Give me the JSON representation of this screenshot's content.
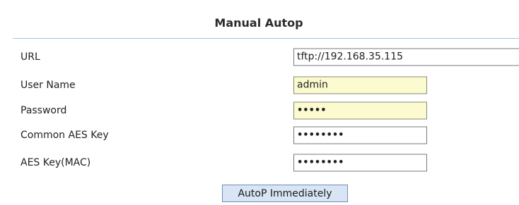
{
  "section": {
    "title": "Manual Autop"
  },
  "fields": {
    "url": {
      "label": "URL",
      "value": "tftp://192.168.35.115"
    },
    "username": {
      "label": "User Name",
      "value": "admin"
    },
    "password": {
      "label": "Password",
      "value": "•••••"
    },
    "common_aes_key": {
      "label": "Common AES Key",
      "value": "••••••••"
    },
    "aes_key_mac": {
      "label": "AES Key(MAC)",
      "value": "••••••••"
    }
  },
  "actions": {
    "autop_immediately": "AutoP Immediately"
  },
  "colors": {
    "header_divider": "#a9c4dc",
    "autofill_yellow": "#fbfbcf",
    "button_bg": "#d9e5f5",
    "button_border": "#6f8db5"
  }
}
